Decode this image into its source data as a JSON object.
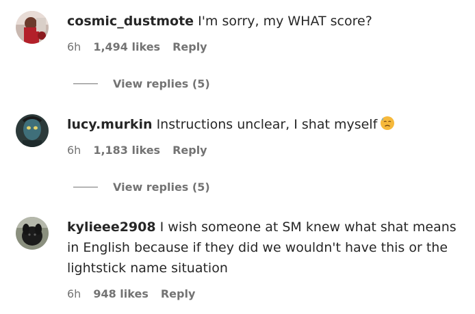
{
  "comments": [
    {
      "username": "cosmic_dustmote",
      "text": "I'm sorry, my WHAT score?",
      "time": "6h",
      "likes": "1,494 likes",
      "reply_label": "Reply",
      "view_replies": "View replies (5)",
      "avatar_icon": "profile-photo"
    },
    {
      "username": "lucy.murkin",
      "text": "Instructions unclear, I shat myself",
      "emoji": "sweat-face-emoji",
      "time": "6h",
      "likes": "1,183 likes",
      "reply_label": "Reply",
      "view_replies": "View replies (5)",
      "avatar_icon": "profile-photo"
    },
    {
      "username": "kylieee2908",
      "text": "I wish someone at SM knew what shat means in English because if they did we wouldn't have this or the lightstick name situation",
      "time": "6h",
      "likes": "948 likes",
      "reply_label": "Reply",
      "avatar_icon": "profile-photo"
    }
  ],
  "colors": {
    "text": "#262626",
    "secondary": "#737373",
    "background": "#ffffff"
  }
}
